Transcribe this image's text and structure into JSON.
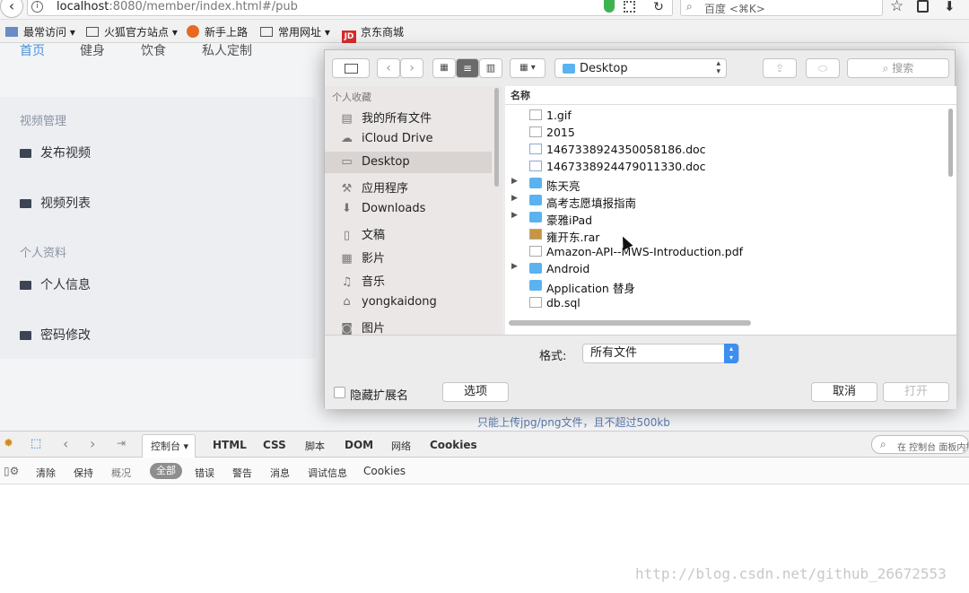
{
  "browser": {
    "url_host": "localhost",
    "url_path": ":8080/member/index.html#/pub",
    "search_placeholder": "百度 <⌘K>"
  },
  "bookmarks": [
    "最常访问",
    "火狐官方站点",
    "新手上路",
    "常用网址",
    "京东商城"
  ],
  "page": {
    "nav": [
      "首页",
      "健身",
      "饮食",
      "私人定制"
    ],
    "sidebar": {
      "section1": "视频管理",
      "items1": [
        "发布视频",
        "视频列表"
      ],
      "section2": "个人资料",
      "items2": [
        "个人信息",
        "密码修改"
      ]
    },
    "upload_hint": "只能上传jpg/png文件，且不超过500kb"
  },
  "dialog": {
    "location": "Desktop",
    "search_placeholder": "搜索",
    "sidebar_header": "个人收藏",
    "sidebar_items": [
      "我的所有文件",
      "iCloud Drive",
      "Desktop",
      "应用程序",
      "Downloads",
      "文稿",
      "影片",
      "音乐",
      "yongkaidong",
      "图片"
    ],
    "sidebar_icons": [
      "all-files-icon",
      "cloud-icon",
      "desktop-icon",
      "applications-icon",
      "downloads-icon",
      "documents-icon",
      "movies-icon",
      "music-icon",
      "home-icon",
      "pictures-icon"
    ],
    "column_header": "名称",
    "files": [
      {
        "name": "1.gif",
        "kind": "gen",
        "folder": false
      },
      {
        "name": "2015",
        "kind": "gen",
        "folder": false
      },
      {
        "name": "1467338924350058186.doc",
        "kind": "doc",
        "folder": false
      },
      {
        "name": "1467338924479011330.doc",
        "kind": "doc",
        "folder": false
      },
      {
        "name": "陈天亮",
        "kind": "folder",
        "folder": true
      },
      {
        "name": "高考志愿填报指南",
        "kind": "folder",
        "folder": true
      },
      {
        "name": "豪雅iPad",
        "kind": "folder",
        "folder": true
      },
      {
        "name": "雍开东.rar",
        "kind": "rar",
        "folder": false
      },
      {
        "name": "Amazon-API--MWS-Introduction.pdf",
        "kind": "gen",
        "folder": false
      },
      {
        "name": "Android",
        "kind": "folder",
        "folder": true
      },
      {
        "name": "Application 替身",
        "kind": "folder",
        "folder": false
      },
      {
        "name": "db.sql",
        "kind": "gen",
        "folder": false
      }
    ],
    "format_label": "格式:",
    "format_value": "所有文件",
    "hide_ext_label": "隐藏扩展名",
    "options_button": "选项",
    "cancel_button": "取消",
    "open_button": "打开"
  },
  "devtools": {
    "tabs": [
      "控制台",
      "HTML",
      "CSS",
      "脚本",
      "DOM",
      "网络",
      "Cookies"
    ],
    "search_placeholder": "在 控制台 面板内搜",
    "filters": [
      "清除",
      "保持",
      "概况",
      "全部",
      "错误",
      "警告",
      "消息",
      "调试信息",
      "Cookies"
    ]
  },
  "watermark": "http://blog.csdn.net/github_26672553"
}
